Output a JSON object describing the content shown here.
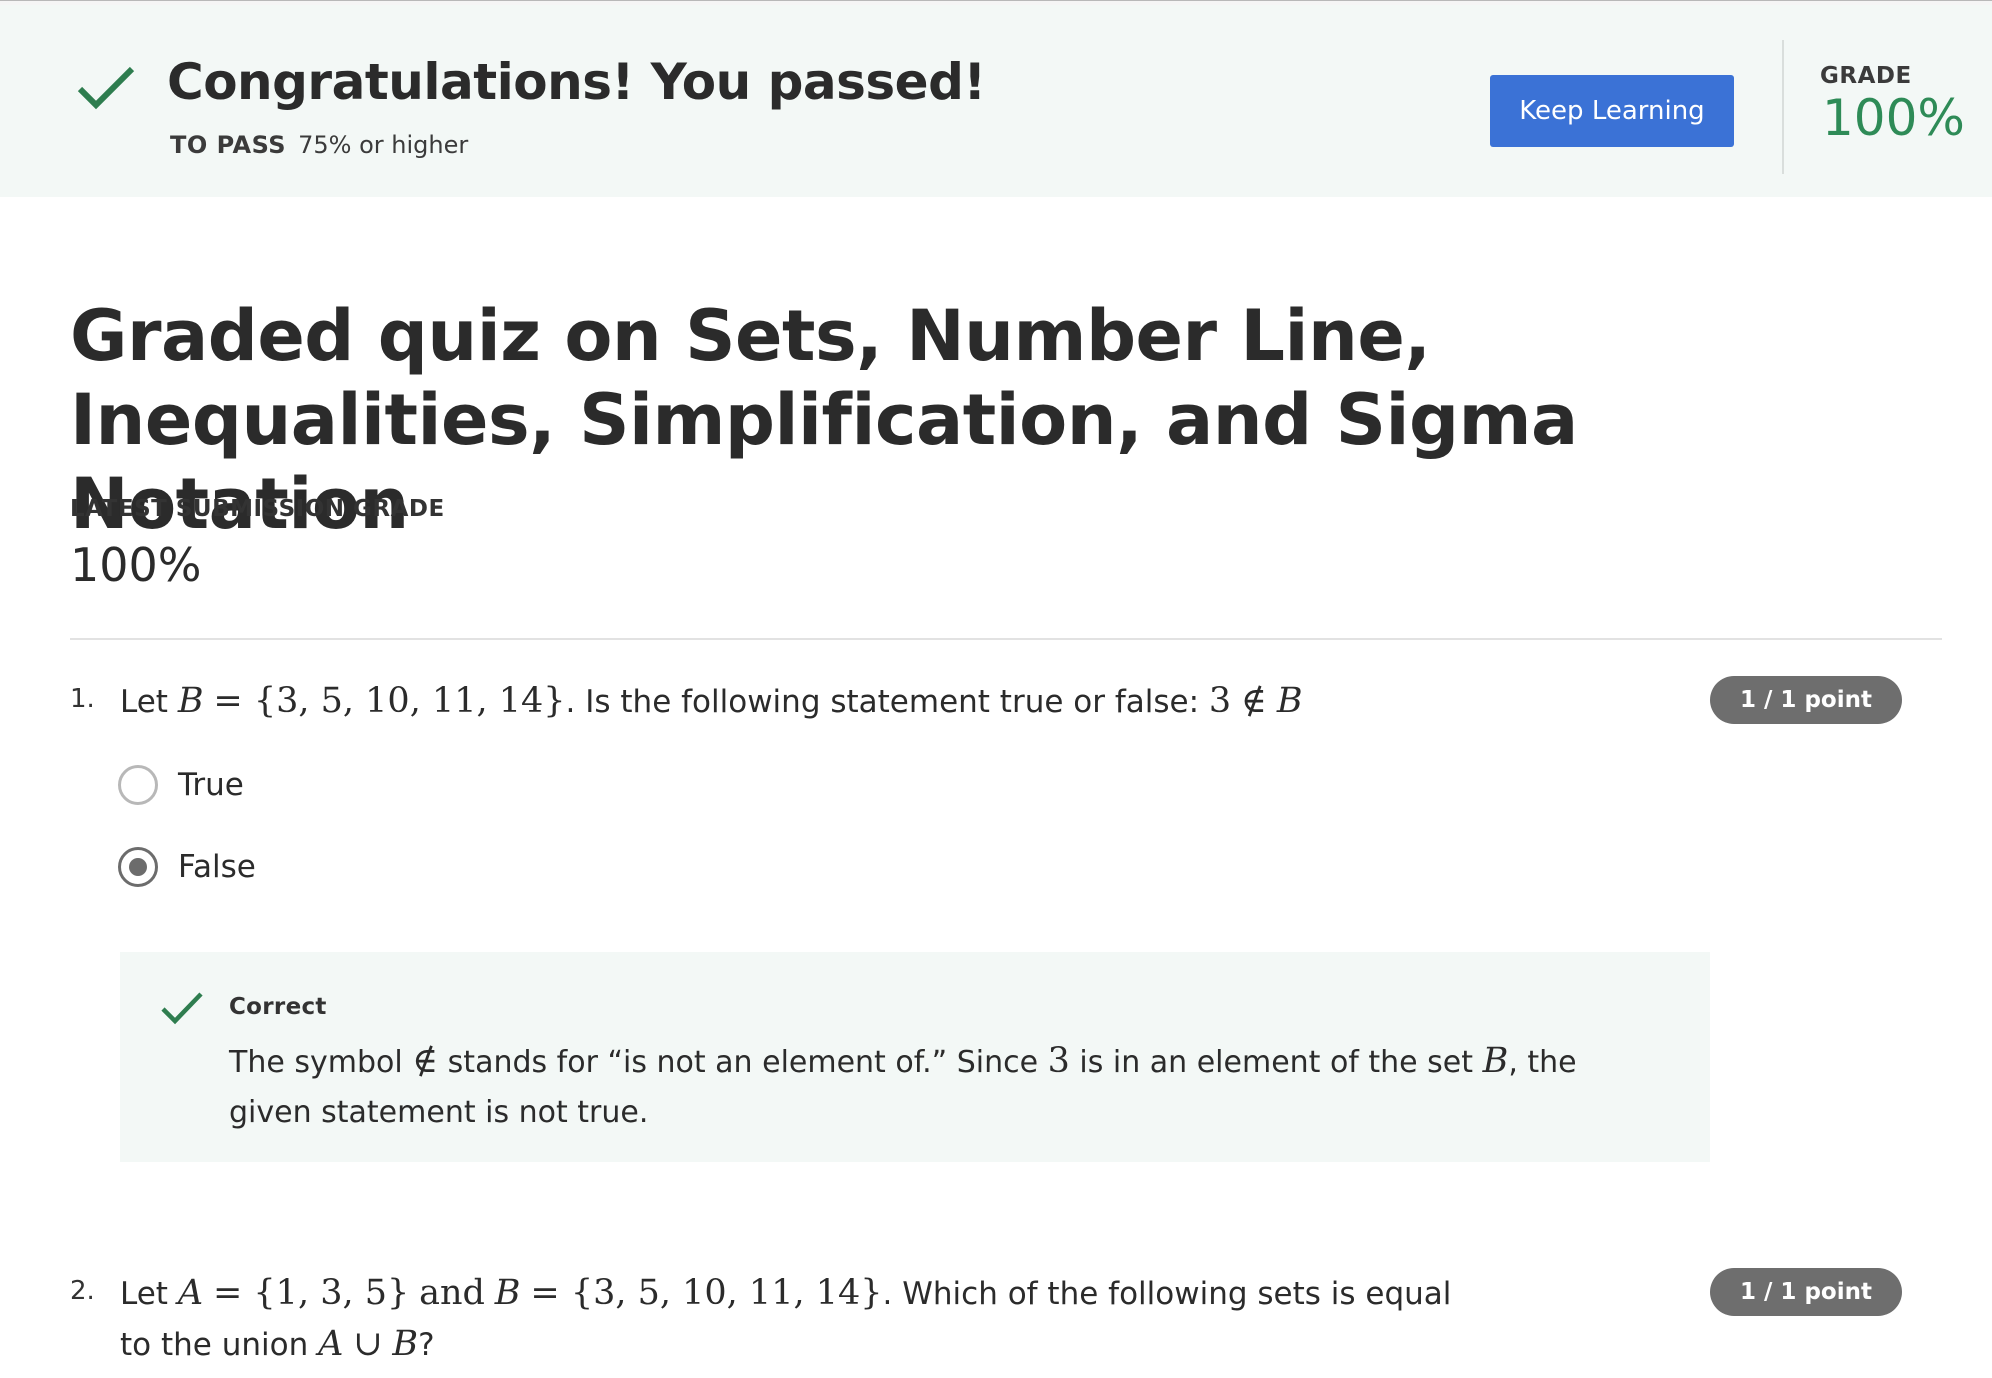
{
  "banner": {
    "title": "Congratulations! You passed!",
    "to_pass_label": "TO PASS",
    "to_pass_value": "75% or higher",
    "keep_learning_label": "Keep Learning",
    "grade_label": "GRADE",
    "grade_value": "100%"
  },
  "quiz": {
    "title": "Graded quiz on Sets, Number Line, Inequalities, Simplification, and Sigma Notation",
    "latest_label": "LATEST SUBMISSION GRADE",
    "latest_value": "100%"
  },
  "questions": [
    {
      "number": "1.",
      "points": "1 / 1 point",
      "options": [
        {
          "label": "True",
          "selected": false
        },
        {
          "label": "False",
          "selected": true
        }
      ],
      "feedback": {
        "title": "Correct"
      }
    },
    {
      "number": "2.",
      "points": "1 / 1 point"
    }
  ],
  "colors": {
    "accent_blue": "#3b72d6",
    "success_green": "#2e8b57",
    "banner_bg": "#f3f8f6"
  }
}
